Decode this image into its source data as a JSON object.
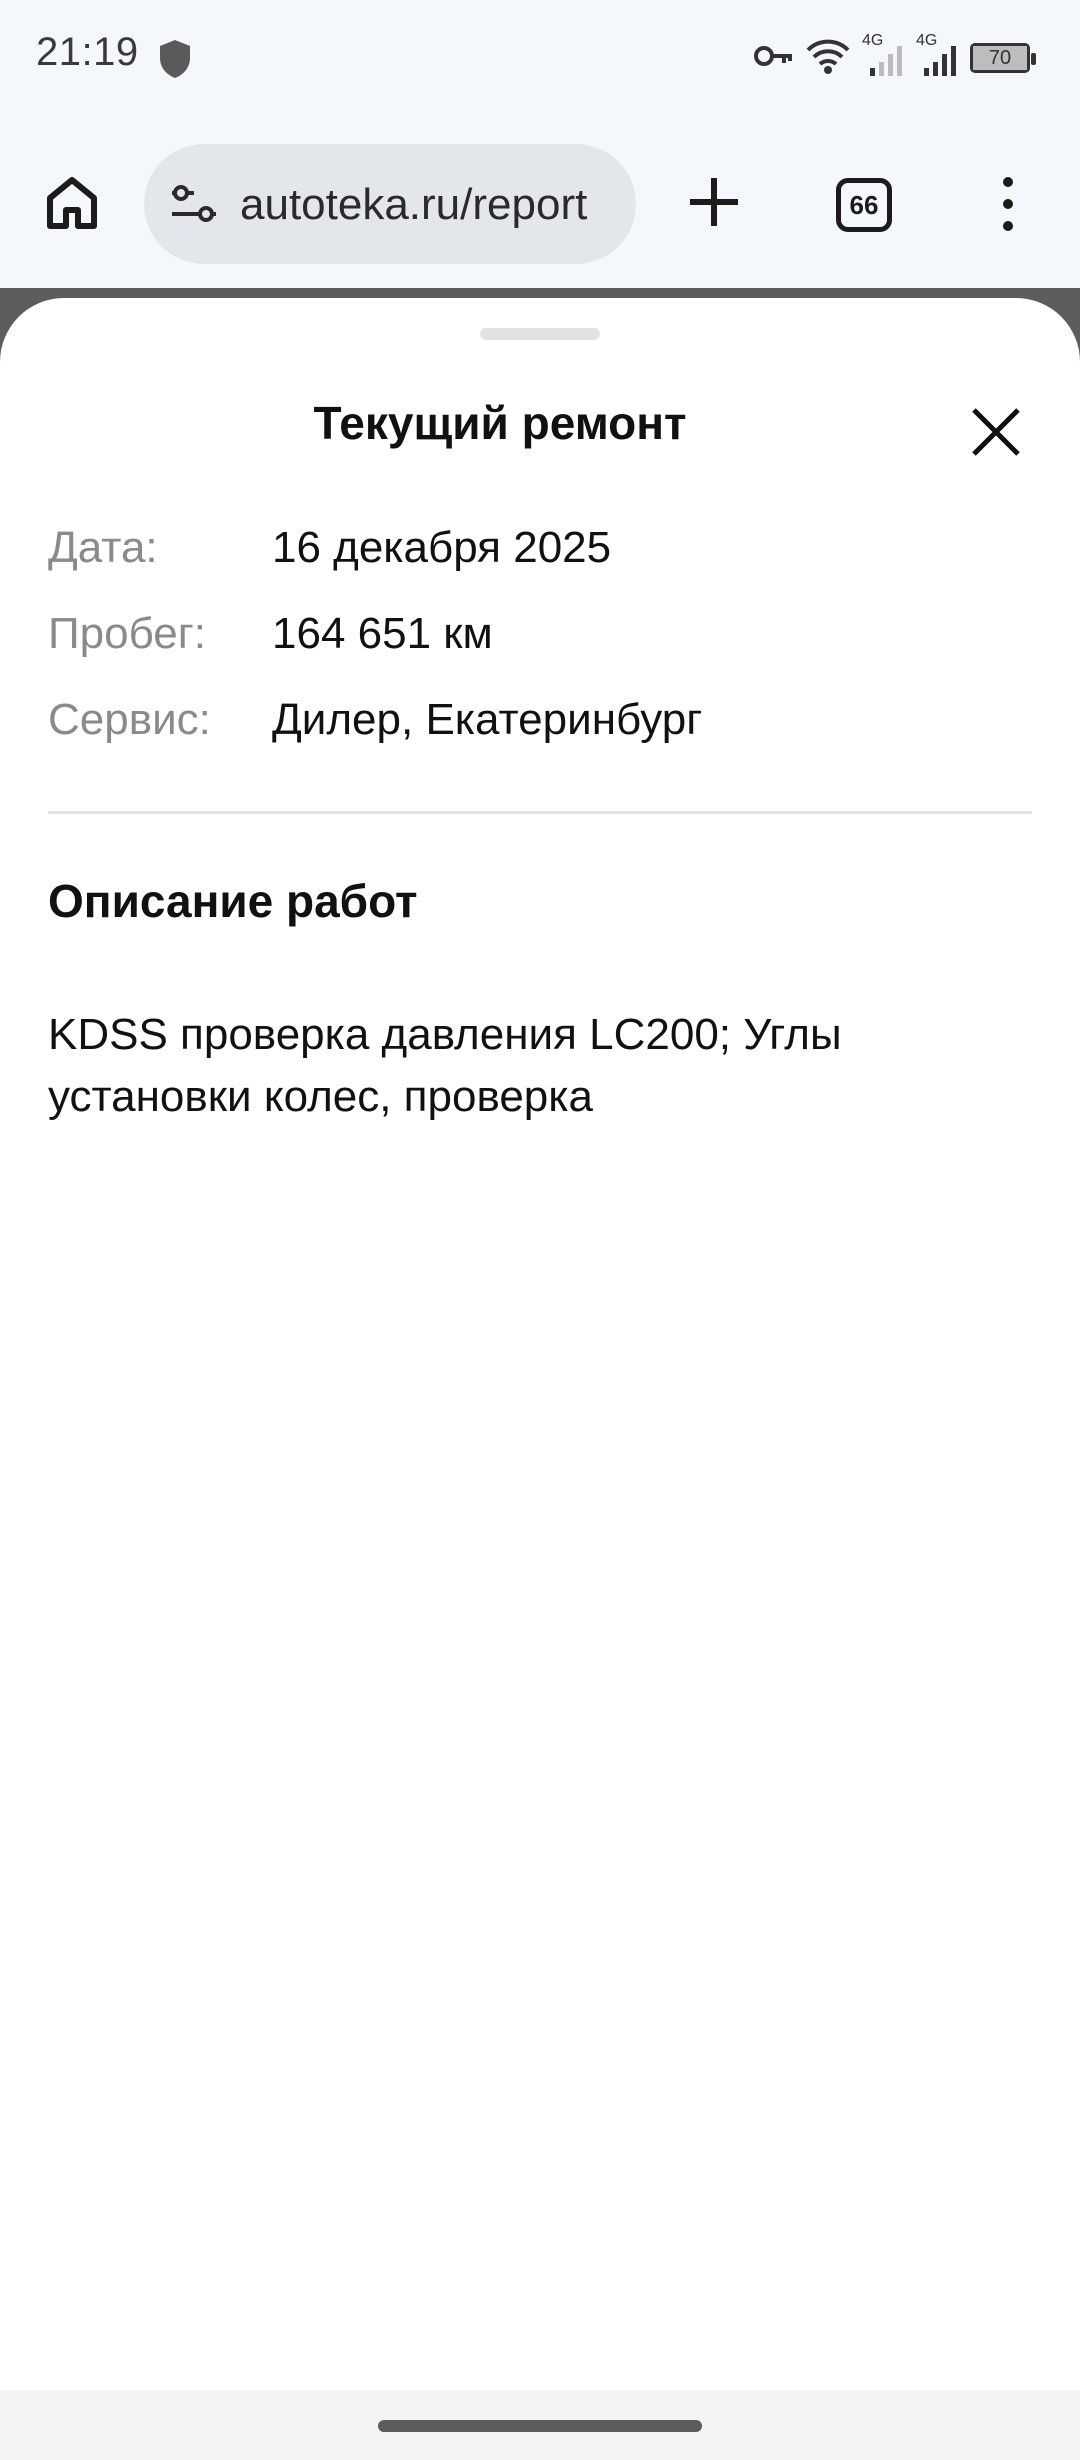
{
  "status_bar": {
    "time": "21:19",
    "network_1": "4G",
    "network_2": "4G",
    "battery": "70",
    "icons": [
      "shield-icon",
      "vpn-key-icon",
      "wifi-icon",
      "signal-icon",
      "battery-icon"
    ]
  },
  "browser": {
    "url": "autoteka.ru/report",
    "tab_count": "66",
    "icons": [
      "home-icon",
      "tune-icon",
      "plus-icon",
      "more-icon"
    ]
  },
  "sheet": {
    "title": "Текущий ремонт",
    "rows": [
      {
        "label": "Дата:",
        "value": "16 декабря 2025"
      },
      {
        "label": "Пробег:",
        "value": "164 651 км"
      },
      {
        "label": "Сервис:",
        "value": "Дилер, Екатеринбург"
      }
    ],
    "section_title": "Описание работ",
    "description": "KDSS проверка давления LC200; Углы установки колес, проверка"
  }
}
